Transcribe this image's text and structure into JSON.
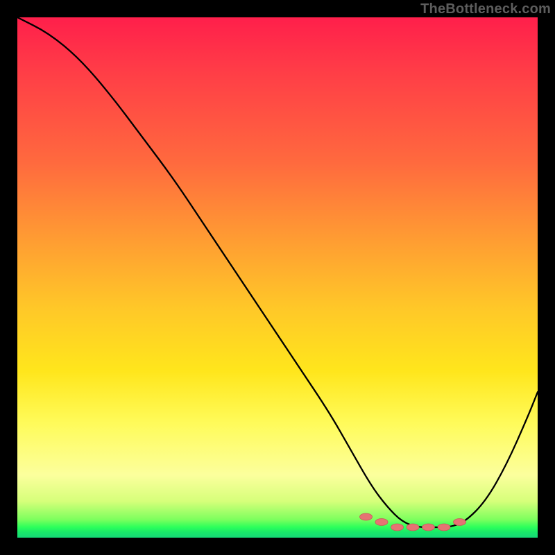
{
  "watermark": "TheBottleneck.com",
  "colors": {
    "background": "#000000",
    "curve": "#000000",
    "marker": "#e57373"
  },
  "chart_data": {
    "type": "line",
    "title": "",
    "xlabel": "",
    "ylabel": "",
    "xlim": [
      0,
      100
    ],
    "ylim": [
      0,
      100
    ],
    "grid": false,
    "series": [
      {
        "name": "bottleneck-curve",
        "x": [
          0,
          6,
          12,
          18,
          24,
          30,
          36,
          42,
          48,
          54,
          60,
          64,
          68,
          71,
          74,
          77,
          80,
          83,
          86,
          90,
          94,
          98,
          100
        ],
        "values": [
          100,
          97,
          92,
          85,
          77,
          69,
          60,
          51,
          42,
          33,
          24,
          17,
          10,
          6,
          3,
          2,
          2,
          2,
          3,
          7,
          14,
          23,
          28
        ]
      }
    ],
    "markers": {
      "name": "highlight-region",
      "x": [
        67,
        70,
        73,
        76,
        79,
        82,
        85
      ],
      "values": [
        4,
        3,
        2,
        2,
        2,
        2,
        3
      ]
    }
  }
}
